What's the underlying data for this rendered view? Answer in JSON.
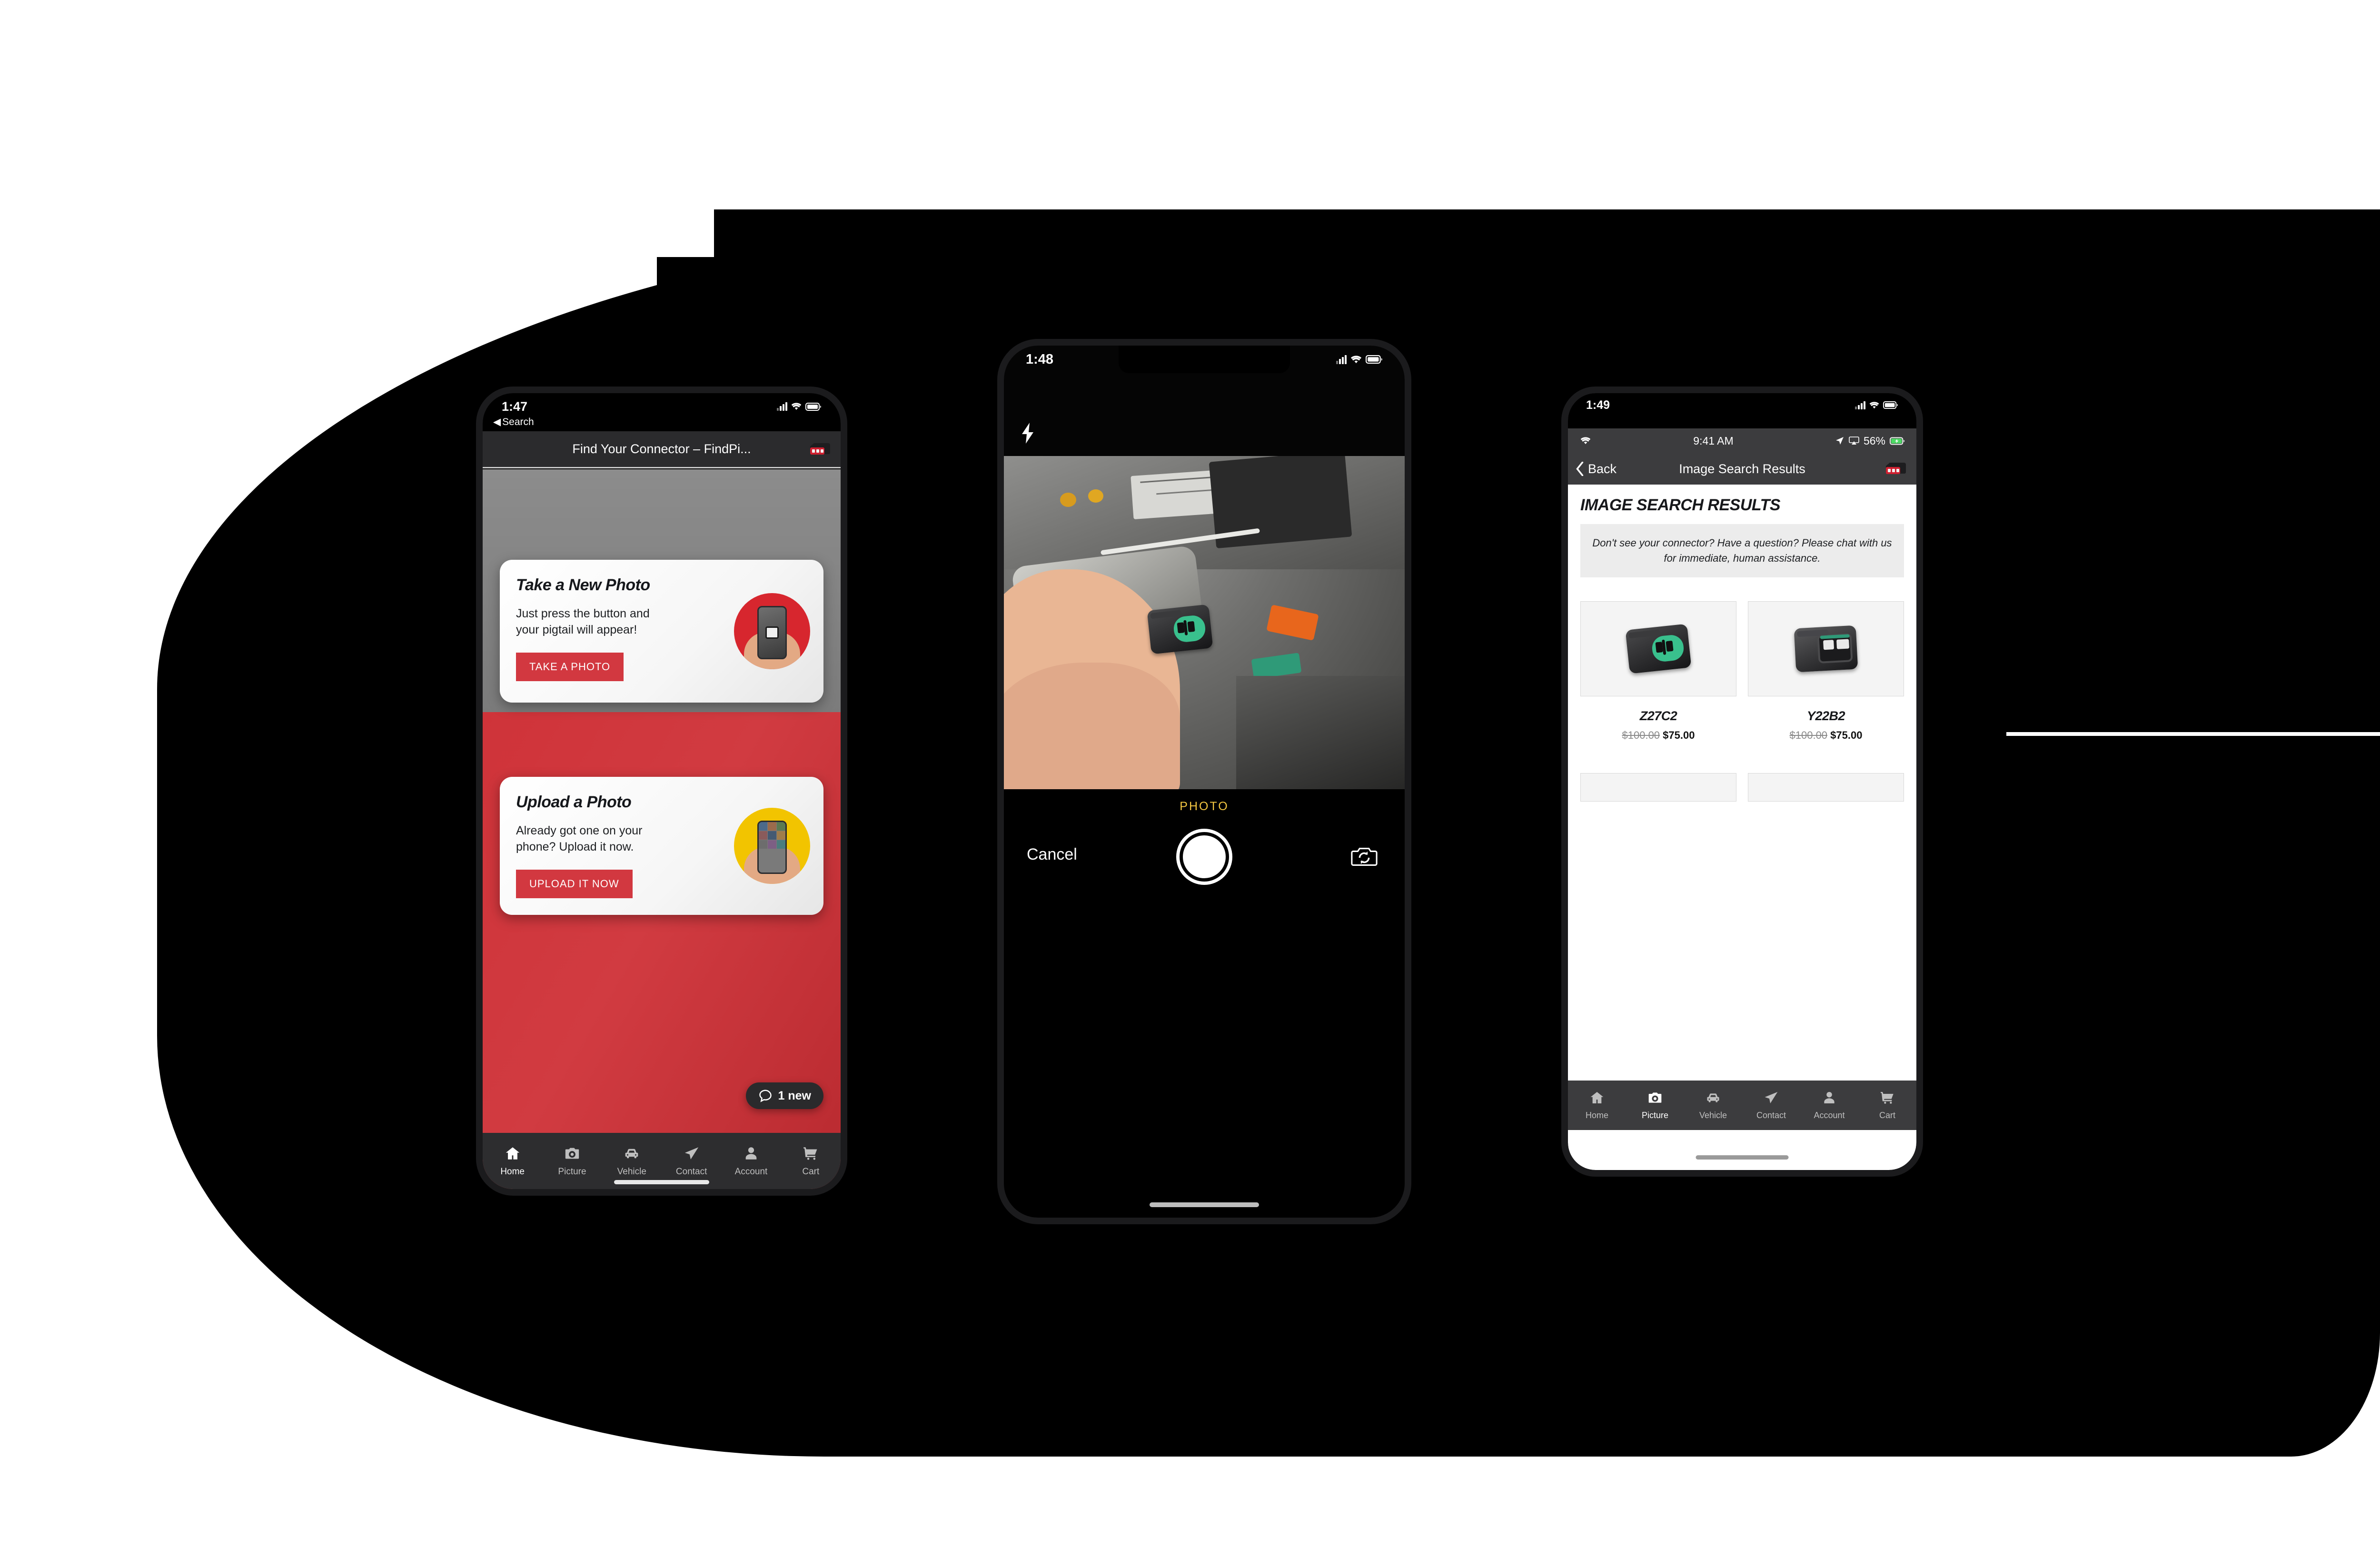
{
  "brand": {
    "red": "#d23840",
    "dark": "#2d2d2f",
    "yellow": "#f2c400"
  },
  "tabbar": {
    "items": [
      {
        "label": "Home",
        "icon": "home-icon"
      },
      {
        "label": "Picture",
        "icon": "camera-icon"
      },
      {
        "label": "Vehicle",
        "icon": "car-icon"
      },
      {
        "label": "Contact",
        "icon": "paper-plane-icon"
      },
      {
        "label": "Account",
        "icon": "person-icon"
      },
      {
        "label": "Cart",
        "icon": "shopping-cart-icon"
      }
    ]
  },
  "phone1": {
    "status": {
      "time": "1:47",
      "back_label": "Search"
    },
    "navbar": {
      "title": "Find Your Connector – FindPi...",
      "logo": "connector-logo-icon"
    },
    "card_take": {
      "title": "Take a New Photo",
      "body": "Just press the button and your pigtail will appear!",
      "button": "TAKE A PHOTO"
    },
    "card_upload": {
      "title": "Upload a Photo",
      "body": "Already got one on your phone? Upload it now.",
      "button": "UPLOAD IT NOW"
    },
    "chat_badge": {
      "icon": "chat-bubble-icon",
      "label": "1 new"
    },
    "active_tab": "Home"
  },
  "phone2": {
    "status": {
      "time": "1:48"
    },
    "flash": "flash-icon",
    "mode_label": "PHOTO",
    "cancel_label": "Cancel",
    "shutter": "shutter-button",
    "flip": "flip-camera-icon",
    "viewfinder_subject": "car engine bay with hand holding a 2-pin green automotive connector"
  },
  "phone3": {
    "status": {
      "time": "1:49"
    },
    "app_status": {
      "time": "9:41 AM",
      "battery": "56%",
      "wifi": "wifi-icon",
      "location": "location-arrow-icon",
      "airplay": "airplay-icon"
    },
    "navbar": {
      "back": "Back",
      "title": "Image Search Results",
      "logo": "connector-logo-icon"
    },
    "heading": "IMAGE SEARCH RESULTS",
    "notice": "Don't see your connector? Have a question? Please chat with us for immediate, human assistance.",
    "products": [
      {
        "name": "Z27C2",
        "old_price": "$100.00",
        "price": "$75.00"
      },
      {
        "name": "Y22B2",
        "old_price": "$100.00",
        "price": "$75.00"
      }
    ],
    "active_tab": "Picture"
  }
}
